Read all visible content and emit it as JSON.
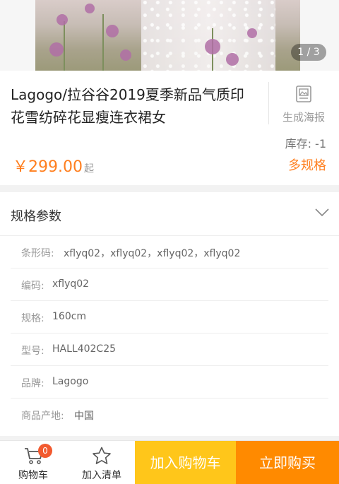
{
  "hero": {
    "pager": "1 / 3"
  },
  "product": {
    "title": "Lagogo/拉谷谷2019夏季新品气质印花雪纺碎花显瘦连衣裙女",
    "poster_label": "生成海报",
    "stock": "库存: -1",
    "price": "￥299.00",
    "price_suffix": "起",
    "multi_spec": "多规格"
  },
  "spec": {
    "title": "规格参数",
    "rows": [
      {
        "key": "条形码:",
        "value": "xflyq02，xflyq02，xflyq02，xflyq02"
      },
      {
        "key": "编码:",
        "value": "xflyq02"
      },
      {
        "key": "规格:",
        "value": "160cm"
      },
      {
        "key": "型号:",
        "value": "HALL402C25"
      },
      {
        "key": "品牌:",
        "value": "Lagogo"
      },
      {
        "key": "商品产地:",
        "value": "中国"
      }
    ]
  },
  "bottom_bar": {
    "cart_label": "购物车",
    "cart_count": "0",
    "list_label": "加入清单",
    "add_cart": "加入购物车",
    "buy_now": "立即购买"
  },
  "colors": {
    "accent": "#ff7f1f",
    "add_cart_bg": "#ffc61a",
    "buy_bg": "#ff8a00",
    "badge": "#f25a2f"
  }
}
